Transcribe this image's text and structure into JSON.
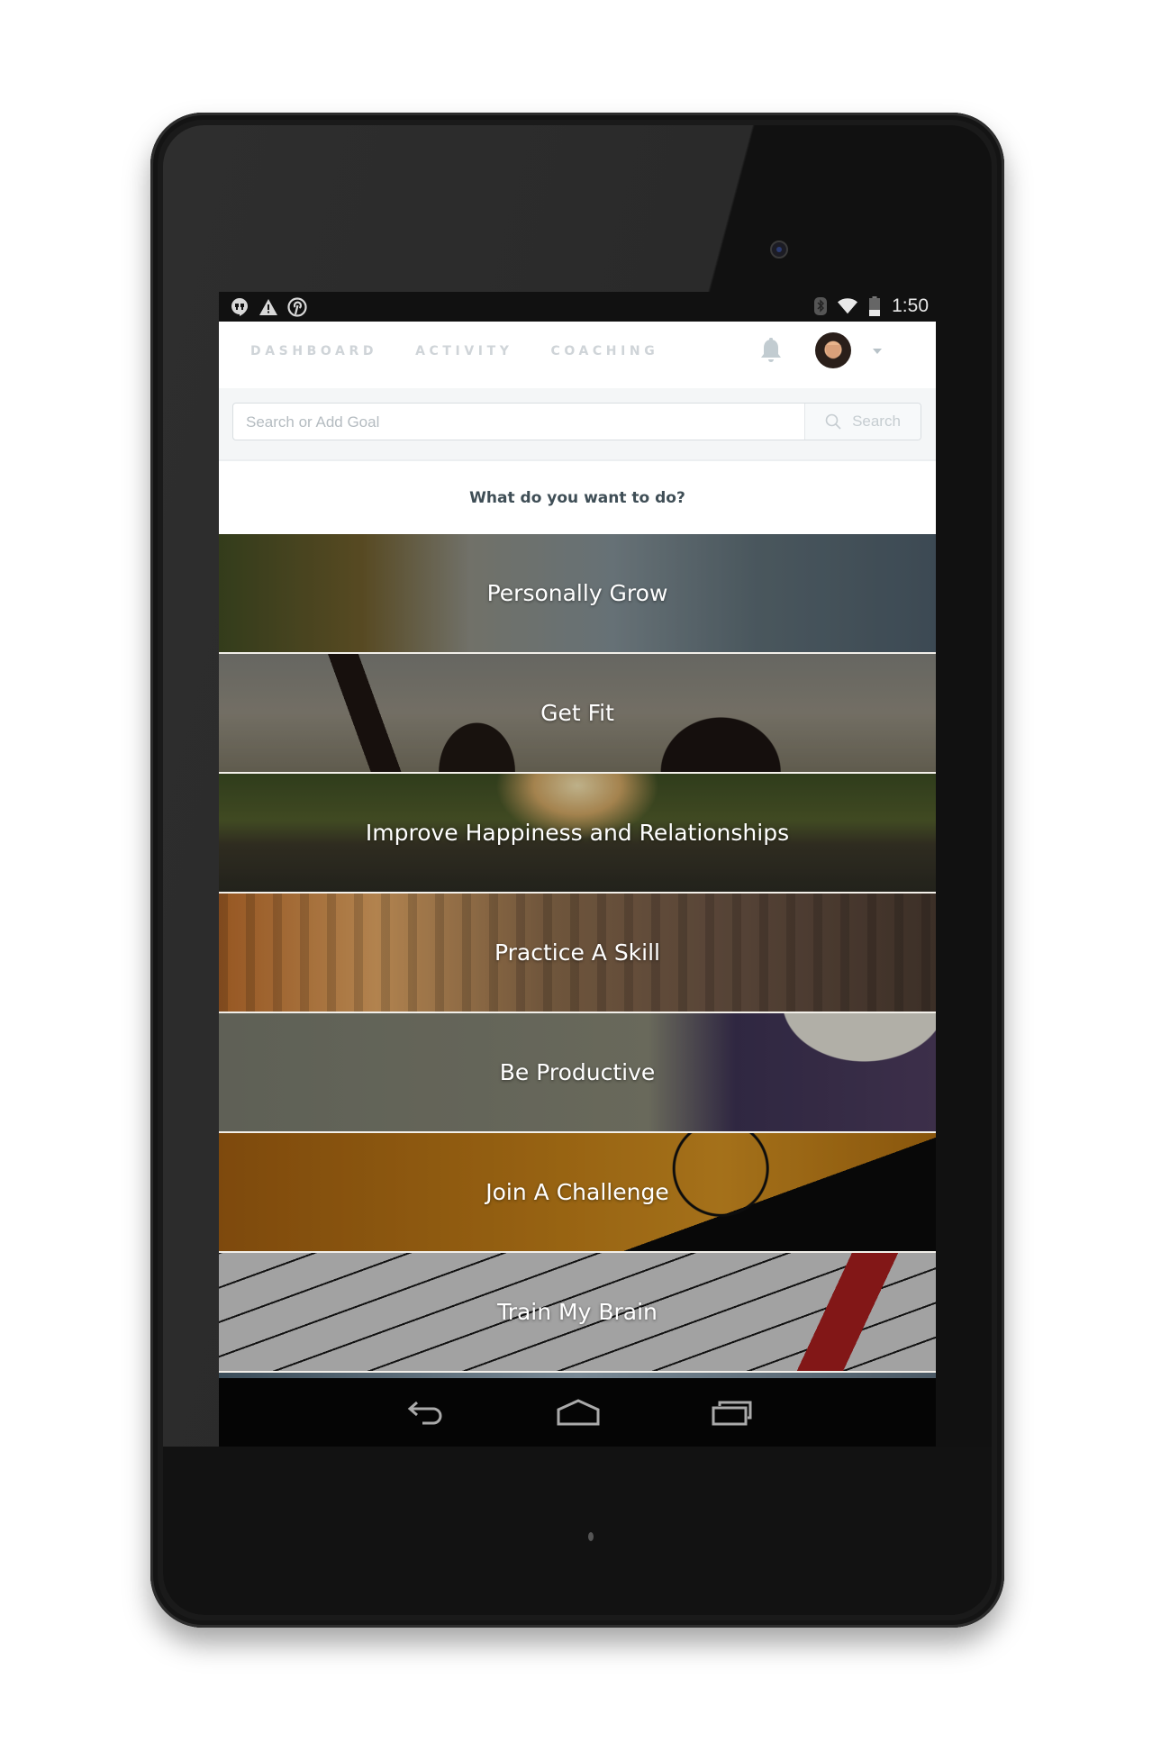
{
  "device": {
    "type": "Android tablet"
  },
  "status_bar": {
    "left_icons": [
      "hangouts-icon",
      "warning-icon",
      "pinterest-icon"
    ],
    "right_icons": [
      "bluetooth-icon",
      "wifi-icon",
      "battery-icon"
    ],
    "time": "1:50"
  },
  "header": {
    "nav": [
      {
        "label": "DASHBOARD"
      },
      {
        "label": "ACTIVITY"
      },
      {
        "label": "COACHING"
      }
    ],
    "notifications_icon": "bell-icon",
    "avatar_icon": "user-avatar",
    "menu_icon": "caret-down-icon"
  },
  "search": {
    "placeholder": "Search or Add Goal",
    "value": "",
    "button_label": "Search",
    "button_icon": "magnifier-icon"
  },
  "prompt": "What do you want to do?",
  "categories": [
    {
      "label": "Personally Grow",
      "scene": "hiker-overlook"
    },
    {
      "label": "Get Fit",
      "scene": "raised-arms-silhouettes"
    },
    {
      "label": "Improve Happiness and Relationships",
      "scene": "sunset-river"
    },
    {
      "label": "Practice A Skill",
      "scene": "guitar-strings"
    },
    {
      "label": "Be Productive",
      "scene": "notebook-pen"
    },
    {
      "label": "Join A Challenge",
      "scene": "cyclist-silhouette"
    },
    {
      "label": "Train My Brain",
      "scene": "crossword-pencil"
    }
  ],
  "colors": {
    "nav_text": "#cfd4d8",
    "prompt_text": "#3f4e56",
    "placeholder": "#b5bcc1",
    "search_band": "#f4f6f7"
  },
  "system_nav": [
    "back-icon",
    "home-icon",
    "recents-icon"
  ]
}
